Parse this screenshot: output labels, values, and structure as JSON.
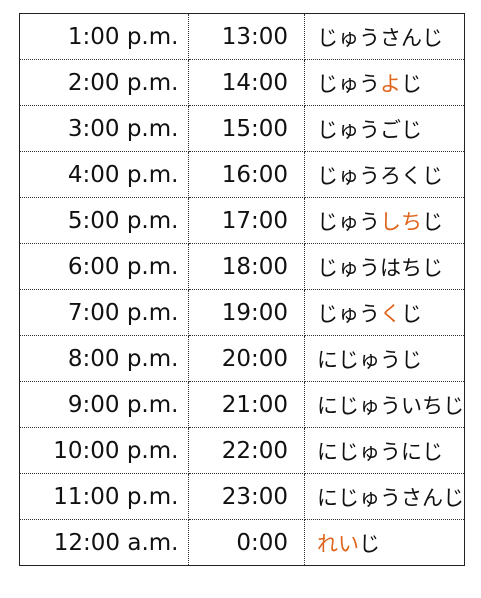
{
  "highlight_color": "#e0651c",
  "rows": [
    {
      "time12": "1:00 p.m.",
      "time24": "13:00",
      "reading": [
        {
          "t": "じゅうさんじ",
          "hl": false
        }
      ]
    },
    {
      "time12": "2:00 p.m.",
      "time24": "14:00",
      "reading": [
        {
          "t": "じゅう",
          "hl": false
        },
        {
          "t": "よ",
          "hl": true
        },
        {
          "t": "じ",
          "hl": false
        }
      ]
    },
    {
      "time12": "3:00 p.m.",
      "time24": "15:00",
      "reading": [
        {
          "t": "じゅうごじ",
          "hl": false
        }
      ]
    },
    {
      "time12": "4:00 p.m.",
      "time24": "16:00",
      "reading": [
        {
          "t": "じゅうろくじ",
          "hl": false
        }
      ]
    },
    {
      "time12": "5:00 p.m.",
      "time24": "17:00",
      "reading": [
        {
          "t": "じゅう",
          "hl": false
        },
        {
          "t": "しち",
          "hl": true
        },
        {
          "t": "じ",
          "hl": false
        }
      ]
    },
    {
      "time12": "6:00 p.m.",
      "time24": "18:00",
      "reading": [
        {
          "t": "じゅうはちじ",
          "hl": false
        }
      ]
    },
    {
      "time12": "7:00 p.m.",
      "time24": "19:00",
      "reading": [
        {
          "t": "じゅう",
          "hl": false
        },
        {
          "t": "く",
          "hl": true
        },
        {
          "t": "じ",
          "hl": false
        }
      ]
    },
    {
      "time12": "8:00 p.m.",
      "time24": "20:00",
      "reading": [
        {
          "t": "にじゅうじ",
          "hl": false
        }
      ]
    },
    {
      "time12": "9:00 p.m.",
      "time24": "21:00",
      "reading": [
        {
          "t": "にじゅういちじ",
          "hl": false
        }
      ]
    },
    {
      "time12": "10:00 p.m.",
      "time24": "22:00",
      "reading": [
        {
          "t": "にじゅうにじ",
          "hl": false
        }
      ]
    },
    {
      "time12": "11:00 p.m.",
      "time24": "23:00",
      "reading": [
        {
          "t": "にじゅうさんじ",
          "hl": false
        }
      ]
    },
    {
      "time12": "12:00 a.m.",
      "time24": "0:00",
      "reading": [
        {
          "t": "れい",
          "hl": true
        },
        {
          "t": "じ",
          "hl": false
        }
      ]
    }
  ]
}
